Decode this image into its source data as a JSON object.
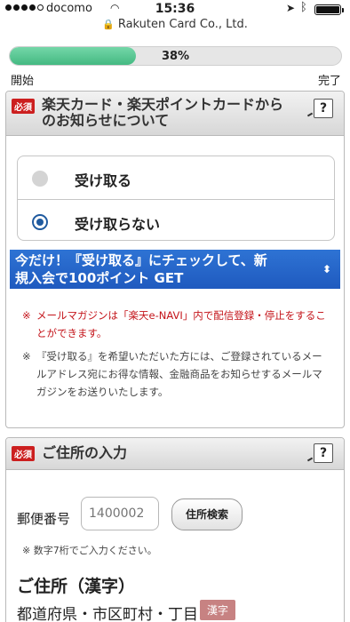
{
  "statusbar": {
    "carrier": "docomo",
    "time": "15:36"
  },
  "urlbar": {
    "domain": "Rakuten Card Co., Ltd."
  },
  "progress": {
    "percent_label": "38%",
    "fraction": 0.38,
    "start_label": "開始",
    "end_label": "完了"
  },
  "section1": {
    "required_badge": "必須",
    "title_line1": "楽天カード・楽天ポイントカードから",
    "title_line2": "のお知らせについて",
    "help_label": "?",
    "options": [
      {
        "label": "受け取る",
        "selected": false
      },
      {
        "label": "受け取らない",
        "selected": true
      }
    ],
    "banner_line1": "今だけ！『受け取る』にチェックして、新",
    "banner_line2": "規入会で100ポイント GET",
    "note1_mark": "※",
    "note1": "メールマガジンは「楽天e-NAVI」内で配信登録・停止をすることができます。",
    "note2_mark": "※",
    "note2": "『受け取る』を希望いただいた方には、ご登録されているメールアドレス宛にお得な情報、金融商品をお知らせするメールマガジンをお送りいたします。"
  },
  "section2": {
    "required_badge": "必須",
    "title": "ご住所の入力",
    "help_label": "?",
    "postal_label": "郵便番号",
    "postal_placeholder": "1400002",
    "search_button": "住所検索",
    "postal_note": "※ 数字7桁でご入力ください。",
    "address_heading": "ご住所（漢字）",
    "pref_label": "都道府県・市区町村・丁目",
    "kanji_badge": "漢字"
  },
  "colors": {
    "accent_blue": "#1f5abf",
    "progress_green": "#44b982",
    "required_red": "#cc1f1f",
    "notice_red": "#c4141a"
  }
}
